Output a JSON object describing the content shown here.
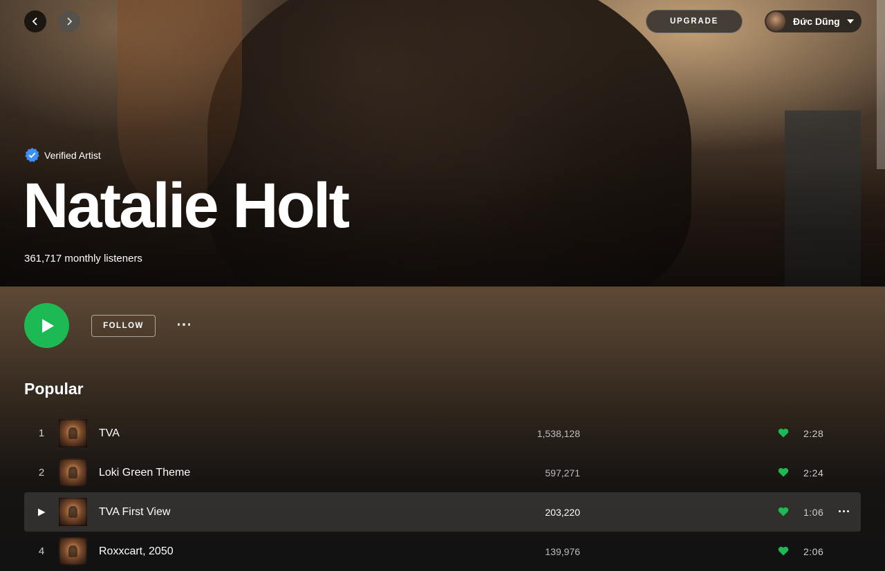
{
  "nav": {
    "back_icon": "chevron-left-icon",
    "forward_icon": "chevron-right-icon"
  },
  "header": {
    "upgrade_label": "UPGRADE",
    "user_name": "Đức Dũng"
  },
  "artist": {
    "verified_label": "Verified Artist",
    "name": "Natalie Holt",
    "monthly_listeners": "361,717 monthly listeners"
  },
  "actions": {
    "follow_label": "FOLLOW"
  },
  "popular": {
    "title": "Popular",
    "tracks": [
      {
        "num": "1",
        "title": "TVA",
        "plays": "1,538,128",
        "duration": "2:28",
        "liked": true
      },
      {
        "num": "2",
        "title": "Loki Green Theme",
        "plays": "597,271",
        "duration": "2:24",
        "liked": true
      },
      {
        "num": "",
        "title": "TVA First View",
        "plays": "203,220",
        "duration": "1:06",
        "liked": true
      },
      {
        "num": "4",
        "title": "Roxxcart, 2050",
        "plays": "139,976",
        "duration": "2:06",
        "liked": true
      }
    ]
  },
  "colors": {
    "accent": "#1db954",
    "verified": "#3d91f4",
    "background": "#121212"
  }
}
